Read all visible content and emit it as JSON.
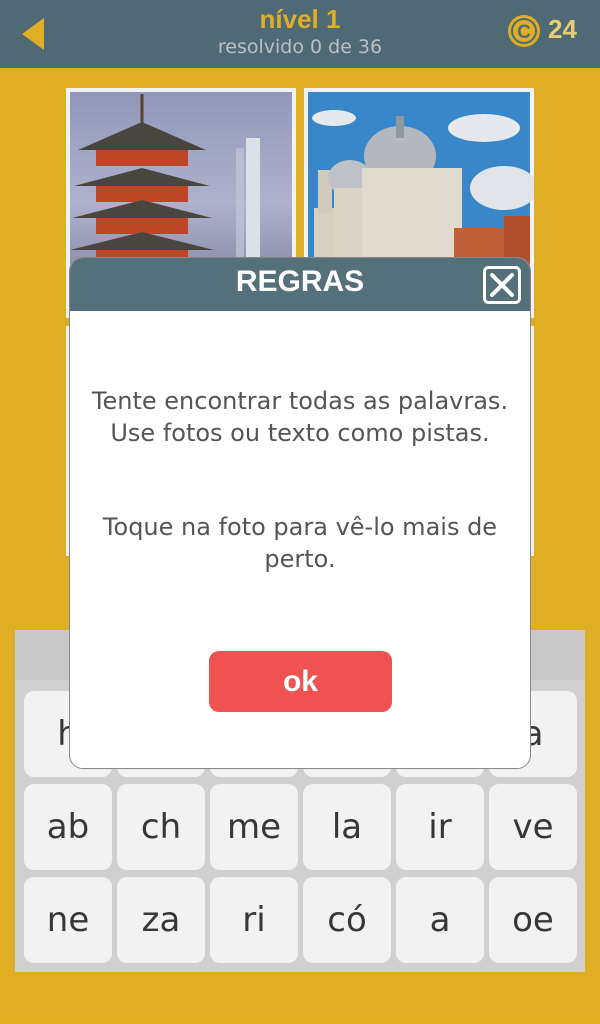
{
  "header": {
    "title": "nível 1",
    "subtitle": "resolvido 0 de 36",
    "coins": "24",
    "back_icon": "back-arrow-icon",
    "coin_icon": "coin-icon"
  },
  "photos": [
    {
      "name": "pagoda-waterfall-photo"
    },
    {
      "name": "domed-church-photo"
    },
    {
      "name": "photo-3"
    },
    {
      "name": "photo-4"
    }
  ],
  "keyboard": {
    "row1": [
      "h",
      "",
      "",
      "",
      "",
      "a"
    ],
    "row2": [
      "ab",
      "ch",
      "me",
      "la",
      "ir",
      "ve"
    ],
    "row3": [
      "ne",
      "za",
      "ri",
      "có",
      "a",
      "oe"
    ]
  },
  "modal": {
    "title": "REGRAS",
    "rule1": "Tente encontrar todas as palavras. Use fotos ou texto como pistas.",
    "rule2": "Toque na foto para vê-lo mais de perto.",
    "ok_label": "ok",
    "close_icon": "close-icon"
  },
  "colors": {
    "background": "#ecb826",
    "header": "#54707b",
    "ok_button": "#f05252",
    "title": "#ecb826"
  }
}
